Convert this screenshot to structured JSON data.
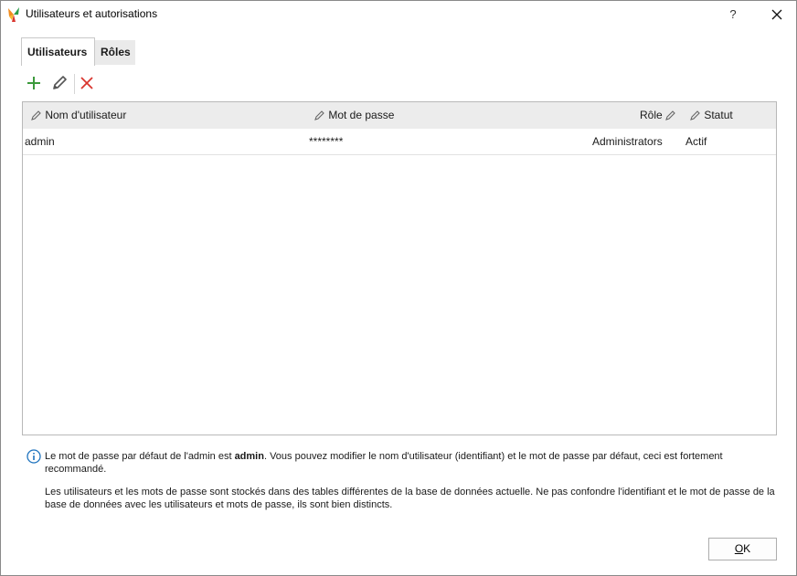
{
  "window": {
    "title": "Utilisateurs et autorisations",
    "help_label": "?"
  },
  "tabs": [
    {
      "label": "Utilisateurs",
      "active": true
    },
    {
      "label": "Rôles",
      "active": false
    }
  ],
  "toolbar": {
    "add_icon": "plus-icon",
    "edit_icon": "pencil-icon",
    "delete_icon": "x-icon",
    "add_color": "#3c9a3c",
    "delete_color": "#d9362f"
  },
  "grid": {
    "columns": [
      {
        "label": "Nom d'utilisateur"
      },
      {
        "label": "Mot de passe"
      },
      {
        "label": "Rôle"
      },
      {
        "label": "Statut"
      }
    ],
    "rows": [
      {
        "username": "admin",
        "password": "********",
        "role": "Administrators",
        "status": "Actif"
      }
    ]
  },
  "notes": {
    "note1_prefix": "Le mot de passe par défaut de l'admin est ",
    "note1_bold": "admin",
    "note1_suffix": ". Vous pouvez modifier le nom d'utilisateur (identifiant) et le mot de passe par défaut, ceci est fortement recommandé.",
    "note2": "Les utilisateurs et les mots de passe sont stockés dans des tables différentes de la base de données actuelle. Ne pas confondre l'identifiant et le mot de passe de la base de données avec les utilisateurs et mots de passe, ils sont bien distincts."
  },
  "buttons": {
    "ok_underlined": "O",
    "ok_rest": "K"
  }
}
